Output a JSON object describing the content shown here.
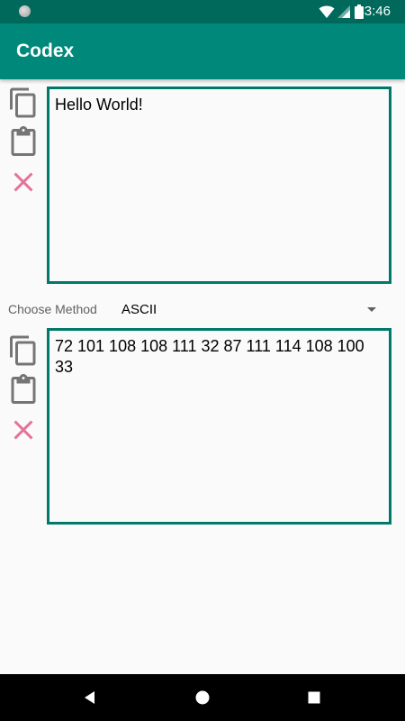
{
  "status_bar": {
    "time": "3:46",
    "icons": [
      "notification-dot-icon",
      "wifi-icon",
      "signal-icon",
      "battery-icon"
    ]
  },
  "app_bar": {
    "title": "Codex",
    "color": "#00897b"
  },
  "input_box": {
    "value": "Hello World!"
  },
  "method": {
    "label": "Choose Method",
    "selected": "ASCII"
  },
  "output_box": {
    "value": "72 101 108 108 111 32 87 111 114 108 100 33"
  },
  "actions": [
    "copy-icon",
    "paste-icon",
    "clear-icon"
  ],
  "colors": {
    "accent": "#00796b",
    "clear": "#e57399",
    "icon": "#757575"
  },
  "nav_bar": {
    "icons": [
      "back-icon",
      "home-icon",
      "recents-icon"
    ]
  }
}
